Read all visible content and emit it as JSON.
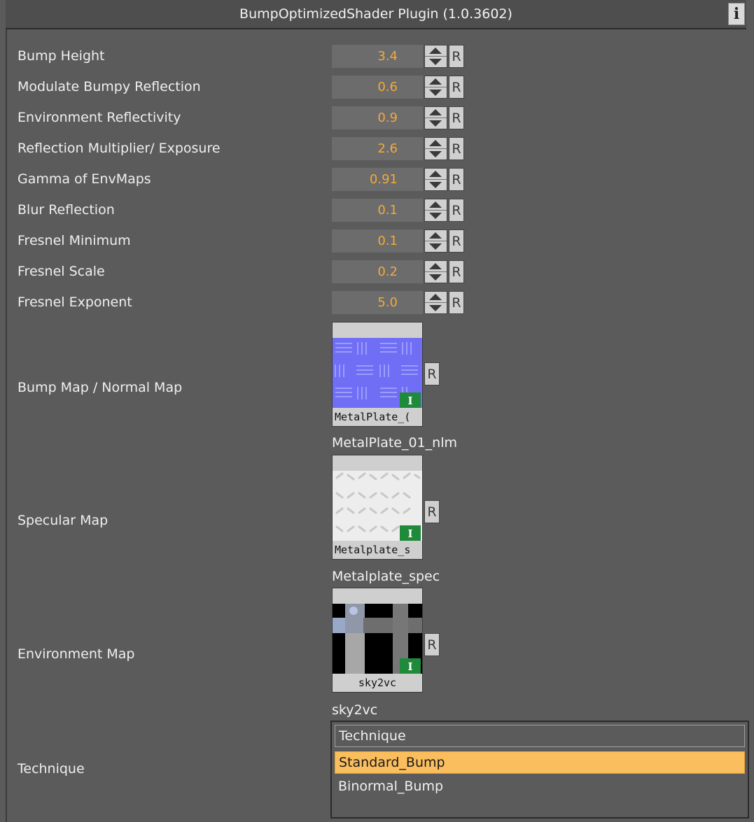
{
  "title": "BumpOptimizedShader Plugin (1.0.3602)",
  "info_label": "i",
  "reset_label": "R",
  "params": [
    {
      "label": "Bump Height",
      "value": "3.4"
    },
    {
      "label": "Modulate Bumpy Reflection",
      "value": "0.6"
    },
    {
      "label": "Environment Reflectivity",
      "value": "0.9"
    },
    {
      "label": "Reflection Multiplier/ Exposure",
      "value": "2.6"
    },
    {
      "label": "Gamma of EnvMaps",
      "value": "0.91"
    },
    {
      "label": "Blur Reflection",
      "value": "0.1"
    },
    {
      "label": "Fresnel Minimum",
      "value": "0.1"
    },
    {
      "label": "Fresnel Scale",
      "value": "0.2"
    },
    {
      "label": "Fresnel Exponent",
      "value": "5.0"
    }
  ],
  "maps": [
    {
      "label": "Bump Map / Normal Map",
      "caption": "MetalPlate_(",
      "name": "MetalPlate_01_nlm",
      "badge": "I",
      "icon": "normal-map-texture"
    },
    {
      "label": "Specular Map",
      "caption": "Metalplate_s",
      "name": "Metalplate_spec",
      "badge": "I",
      "icon": "specular-map-texture"
    },
    {
      "label": "Environment Map",
      "caption": "sky2vc",
      "name": "sky2vc",
      "badge": "I",
      "icon": "cubemap-texture"
    }
  ],
  "technique": {
    "label": "Technique",
    "header": "Technique",
    "options": [
      "Standard_Bump",
      "Binormal_Bump"
    ],
    "selected": "Standard_Bump"
  },
  "colors": {
    "value_text": "#f3a93a",
    "selected_bg": "#fbbe5e",
    "badge": "#1f8a3a"
  }
}
